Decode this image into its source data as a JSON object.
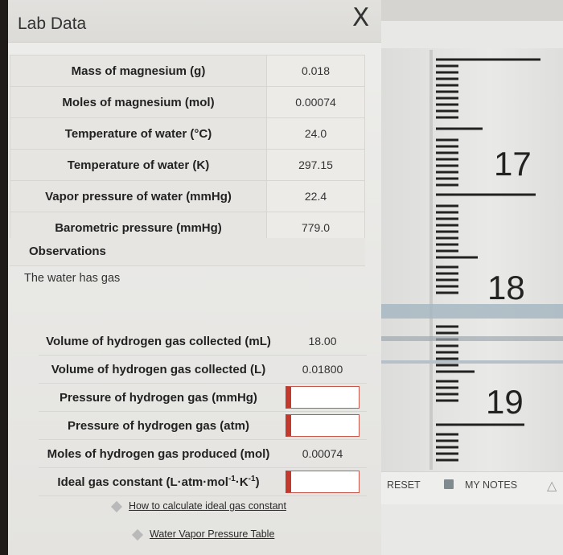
{
  "panel": {
    "title": "Lab Data",
    "close_icon_glyph": "X"
  },
  "data_table": [
    {
      "label": "Mass of magnesium (g)",
      "value": "0.018"
    },
    {
      "label": "Moles of magnesium (mol)",
      "value": "0.00074"
    },
    {
      "label": "Temperature of water (°C)",
      "value": "24.0"
    },
    {
      "label": "Temperature of water (K)",
      "value": "297.15"
    },
    {
      "label": "Vapor pressure of water (mmHg)",
      "value": "22.4"
    },
    {
      "label": "Barometric pressure (mmHg)",
      "value": "779.0"
    }
  ],
  "observations": {
    "label": "Observations",
    "text": "The water has gas"
  },
  "results_table": {
    "volume_ml": {
      "label": "Volume of hydrogen gas collected (mL)",
      "value": "18.00"
    },
    "volume_l": {
      "label": "Volume of hydrogen gas collected (L)",
      "value": "0.01800"
    },
    "pressure_mmhg": {
      "label": "Pressure of hydrogen gas (mmHg)",
      "value": ""
    },
    "pressure_atm": {
      "label": "Pressure of hydrogen gas (atm)",
      "value": ""
    },
    "moles_h2": {
      "label": "Moles of hydrogen gas produced (mol)",
      "value": "0.00074"
    },
    "gas_constant": {
      "label_main": "Ideal gas constant (L·atm·mol",
      "sup1": "-1",
      "mid": "·K",
      "sup2": "-1",
      "end": ")",
      "value": ""
    }
  },
  "links": {
    "ideal_gas": "How to calculate ideal gas constant",
    "vapor_table": "Water Vapor Pressure Table"
  },
  "burette": {
    "labels": [
      "17",
      "18",
      "19"
    ]
  },
  "toolbar": {
    "reset": "RESET",
    "my_notes": "MY NOTES"
  },
  "colors": {
    "input_accent": "#c23a2e",
    "water_band": "#a7b9c2"
  }
}
